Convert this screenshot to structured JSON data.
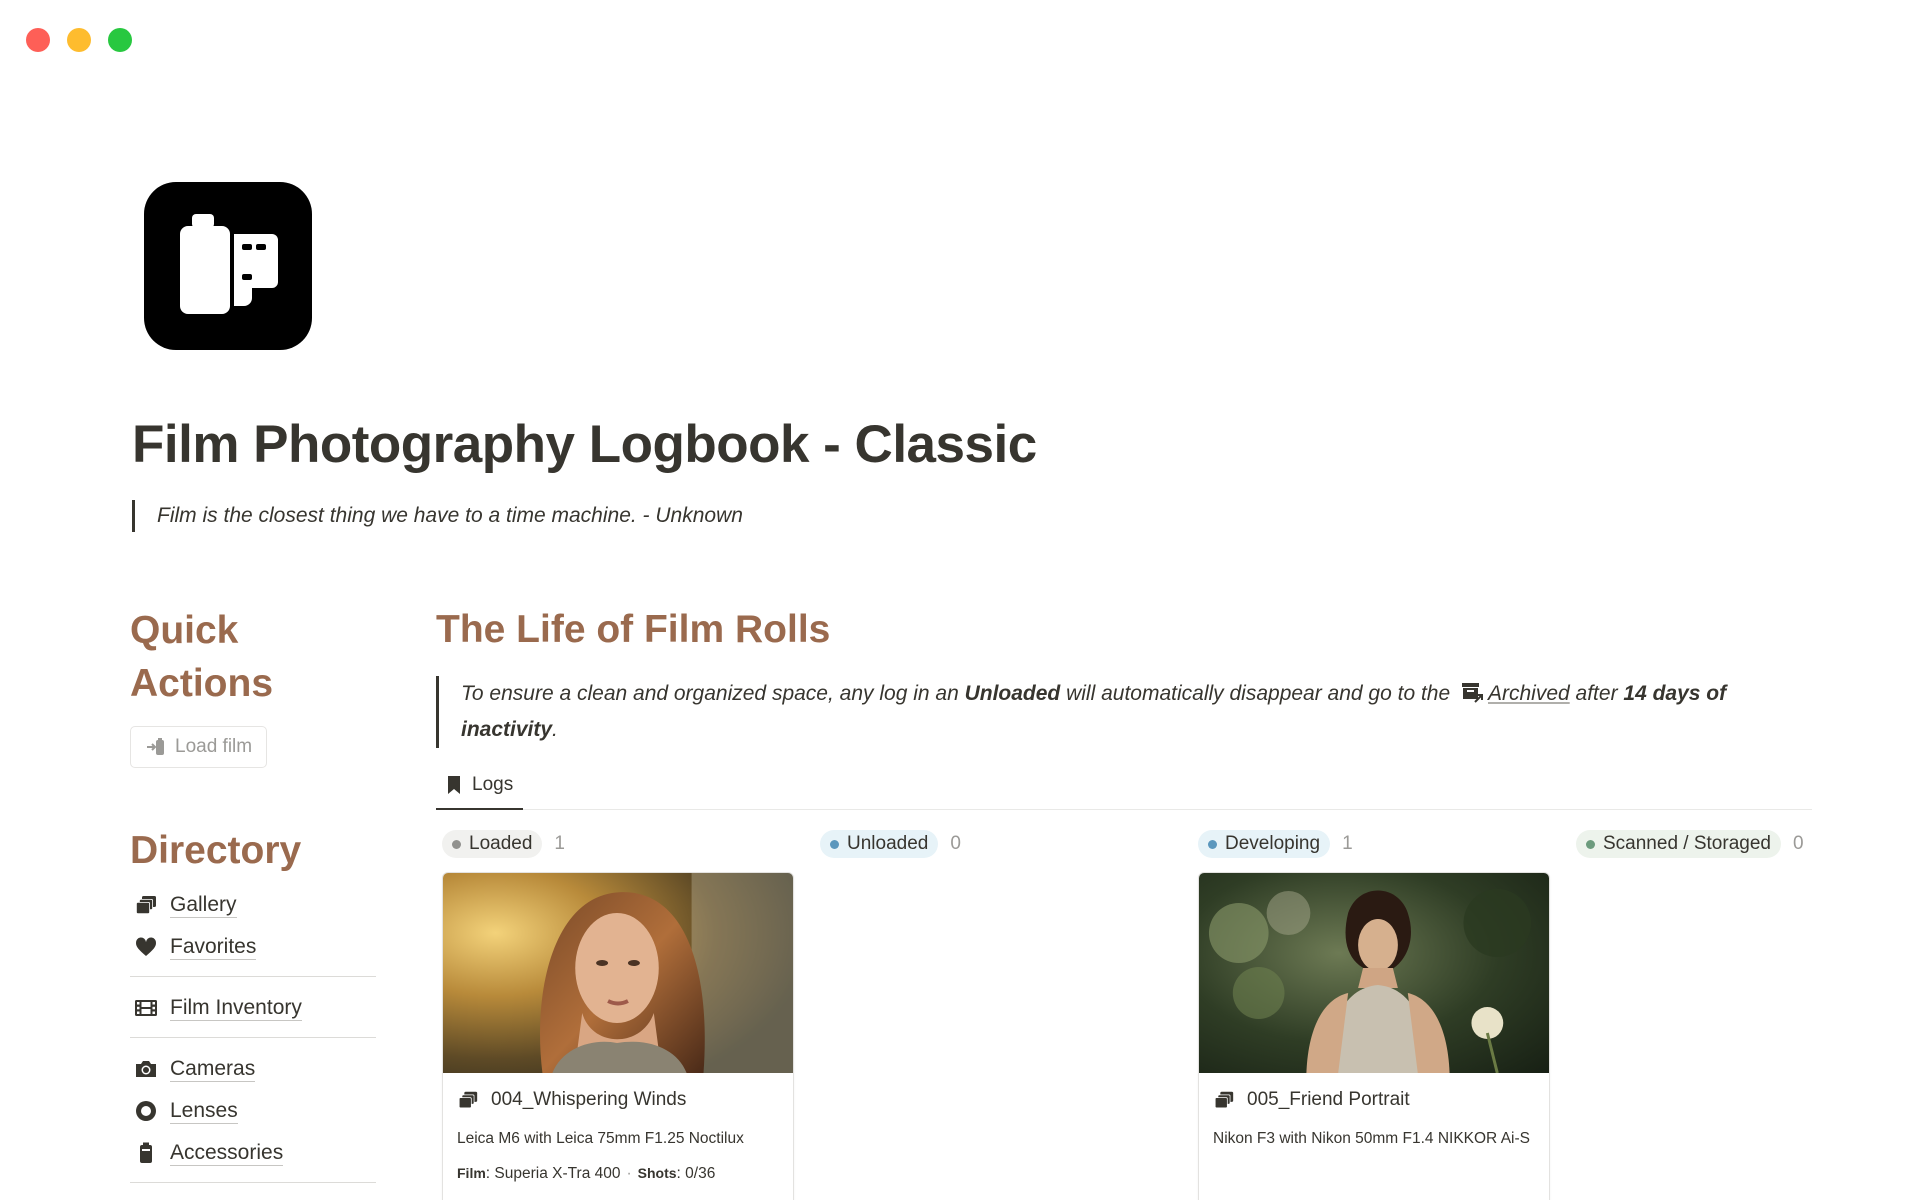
{
  "page": {
    "title": "Film Photography Logbook - Classic",
    "quote": "Film is the closest thing we have to a time machine. - Unknown"
  },
  "quick_actions": {
    "heading_line1": "Quick",
    "heading_line2": "Actions",
    "load_button": "Load film"
  },
  "directory": {
    "heading": "Directory",
    "items": [
      {
        "label": "Gallery",
        "icon": "gallery-icon"
      },
      {
        "label": "Favorites",
        "icon": "heart-icon"
      },
      {
        "label": "Film Inventory",
        "icon": "film-strip-icon"
      },
      {
        "label": "Cameras",
        "icon": "camera-icon"
      },
      {
        "label": "Lenses",
        "icon": "lens-icon"
      },
      {
        "label": "Accessories",
        "icon": "battery-icon"
      }
    ]
  },
  "life": {
    "heading": "The Life of Film Rolls",
    "callout": {
      "part1": "To ensure a clean and organized space, any log in an ",
      "bold1": "Unloaded",
      "part2": " will automatically disappear and go to the ",
      "link": "Archived",
      "part3": " after ",
      "bold2": "14 days of inactivity",
      "part4": "."
    },
    "tab": "Logs"
  },
  "board": {
    "columns": [
      {
        "label": "Loaded",
        "count": "1",
        "dot_color": "#91918e",
        "pill_bg": "#f1f1ef"
      },
      {
        "label": "Unloaded",
        "count": "0",
        "dot_color": "#5b97bd",
        "pill_bg": "#e7f3f8"
      },
      {
        "label": "Developing",
        "count": "1",
        "dot_color": "#5b97bd",
        "pill_bg": "#e7f3f8"
      },
      {
        "label": "Scanned / Storaged",
        "count": "0",
        "dot_color": "#6c9b7d",
        "pill_bg": "#edf3ec"
      }
    ],
    "cards": [
      {
        "title": "004_Whispering Winds",
        "subtitle": "Leica M6 with Leica 75mm F1.25 Noctilux",
        "film_label": "Film",
        "film": "Superia X-Tra 400",
        "shots_label": "Shots",
        "shots": "0/36"
      },
      {
        "title": "005_Friend Portrait",
        "subtitle": "Nikon F3 with Nikon 50mm F1.4 NIKKOR Ai-S"
      }
    ]
  },
  "colors": {
    "accent_brown": "#9a6a4e",
    "text": "#37352f",
    "muted": "#9b9a97"
  }
}
